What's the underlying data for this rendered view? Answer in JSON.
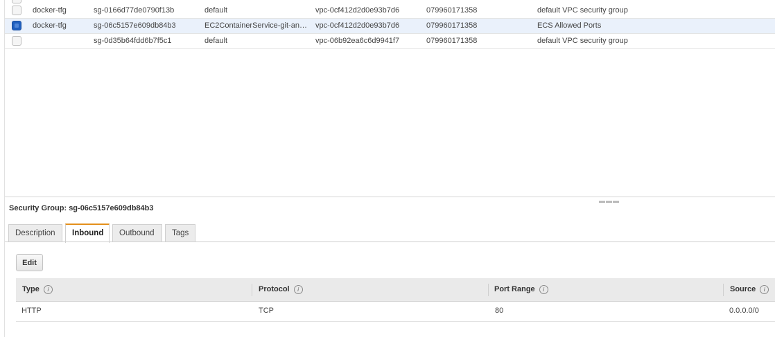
{
  "security_groups": [
    {
      "name": "docker-tfg",
      "group_id": "sg-0166d77de0790f13b",
      "group_name": "default",
      "vpc_id": "vpc-0cf412d2d0e93b7d6",
      "owner": "079960171358",
      "description": "default VPC security group",
      "checked": false
    },
    {
      "name": "docker-tfg",
      "group_id": "sg-06c5157e609db84b3",
      "group_name": "EC2ContainerService-git-an…",
      "vpc_id": "vpc-0cf412d2d0e93b7d6",
      "owner": "079960171358",
      "description": "ECS Allowed Ports",
      "checked": true
    },
    {
      "name": "",
      "group_id": "sg-0d35b64fdd6b7f5c1",
      "group_name": "default",
      "vpc_id": "vpc-06b92ea6c6d9941f7",
      "owner": "079960171358",
      "description": "default VPC security group",
      "checked": false
    }
  ],
  "details": {
    "title_label": "Security Group:",
    "title_value": "sg-06c5157e609db84b3",
    "tabs": [
      "Description",
      "Inbound",
      "Outbound",
      "Tags"
    ],
    "active_tab": "Inbound",
    "edit_label": "Edit"
  },
  "rules": {
    "headers": [
      "Type",
      "Protocol",
      "Port Range",
      "Source"
    ],
    "info_glyph": "i",
    "rows": [
      {
        "type": "HTTP",
        "protocol": "TCP",
        "port_range": "80",
        "source": "0.0.0.0/0"
      }
    ]
  },
  "colors": {
    "selected_row": "#eaf1fb",
    "checkbox_on": "#1f5fbf",
    "active_tab_accent": "#e4901c"
  }
}
